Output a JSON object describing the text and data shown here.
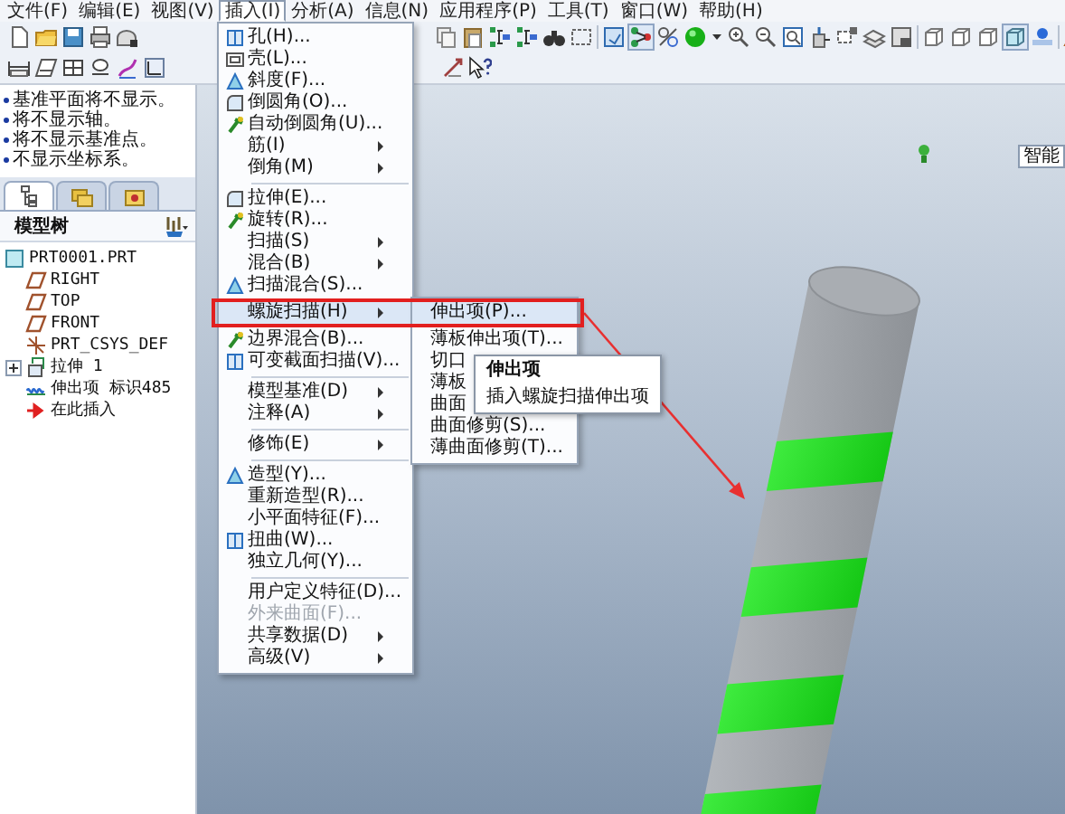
{
  "menu_bar": [
    {
      "label": "文件(F)",
      "selected": false
    },
    {
      "label": "编辑(E)",
      "selected": false
    },
    {
      "label": "视图(V)",
      "selected": false
    },
    {
      "label": "插入(I)",
      "selected": true
    },
    {
      "label": "分析(A)",
      "selected": false
    },
    {
      "label": "信息(N)",
      "selected": false
    },
    {
      "label": "应用程序(P)",
      "selected": false
    },
    {
      "label": "工具(T)",
      "selected": false
    },
    {
      "label": "窗口(W)",
      "selected": false
    },
    {
      "label": "帮助(H)",
      "selected": false
    }
  ],
  "messages": [
    "基准平面将不显示。",
    "将不显示轴。",
    "将不显示基准点。",
    "不显示坐标系。"
  ],
  "panel_tabs": [
    {
      "kind": "tree",
      "selected": true
    },
    {
      "kind": "folders",
      "selected": false
    },
    {
      "kind": "favorites",
      "selected": false
    }
  ],
  "model_tree": {
    "title": "模型树",
    "items": [
      {
        "label": "PRT0001.PRT",
        "kind": "part",
        "children": [
          {
            "label": "RIGHT",
            "kind": "plane"
          },
          {
            "label": "TOP",
            "kind": "plane"
          },
          {
            "label": "FRONT",
            "kind": "plane"
          },
          {
            "label": "PRT_CSYS_DEF",
            "kind": "csys"
          },
          {
            "label": "拉伸 1",
            "kind": "extrude",
            "expanded": false
          },
          {
            "label": "伸出项 标识485",
            "kind": "helix"
          },
          {
            "label": "在此插入",
            "kind": "insert"
          }
        ]
      }
    ]
  },
  "insert_menu": {
    "items": [
      {
        "label": "孔(H)...",
        "kind": "action",
        "icon": true,
        "selected": false,
        "disabled": false
      },
      {
        "label": "壳(L)...",
        "kind": "action",
        "icon": true,
        "selected": false,
        "disabled": false
      },
      {
        "label": "斜度(F)...",
        "kind": "action",
        "icon": true,
        "selected": false,
        "disabled": false
      },
      {
        "label": "倒圆角(O)...",
        "kind": "action",
        "icon": true,
        "selected": false,
        "disabled": false
      },
      {
        "label": "自动倒圆角(U)...",
        "kind": "action",
        "icon": true,
        "selected": false,
        "disabled": false
      },
      {
        "label": "筋(I)",
        "kind": "submenu",
        "selected": false,
        "disabled": false
      },
      {
        "label": "倒角(M)",
        "kind": "submenu",
        "selected": false,
        "disabled": false
      },
      {
        "kind": "separator"
      },
      {
        "label": "拉伸(E)...",
        "kind": "action",
        "icon": true,
        "selected": false,
        "disabled": false
      },
      {
        "label": "旋转(R)...",
        "kind": "action",
        "icon": true,
        "selected": false,
        "disabled": false
      },
      {
        "label": "扫描(S)",
        "kind": "submenu",
        "selected": false,
        "disabled": false
      },
      {
        "label": "混合(B)",
        "kind": "submenu",
        "selected": false,
        "disabled": false
      },
      {
        "label": "扫描混合(S)...",
        "kind": "action",
        "icon": true,
        "selected": false,
        "disabled": false
      },
      {
        "label": "螺旋扫描(H)",
        "kind": "submenu",
        "selected": true,
        "disabled": false
      },
      {
        "label": "边界混合(B)...",
        "kind": "action",
        "icon": true,
        "selected": false,
        "disabled": false
      },
      {
        "label": "可变截面扫描(V)...",
        "kind": "action",
        "icon": true,
        "selected": false,
        "disabled": false
      },
      {
        "kind": "separator"
      },
      {
        "label": "模型基准(D)",
        "kind": "submenu",
        "selected": false,
        "disabled": false
      },
      {
        "label": "注释(A)",
        "kind": "submenu",
        "selected": false,
        "disabled": false
      },
      {
        "kind": "separator"
      },
      {
        "label": "修饰(E)",
        "kind": "submenu",
        "selected": false,
        "disabled": false
      },
      {
        "kind": "separator"
      },
      {
        "label": "造型(Y)...",
        "kind": "action",
        "icon": true,
        "selected": false,
        "disabled": false
      },
      {
        "label": "重新造型(R)...",
        "kind": "action",
        "selected": false,
        "disabled": false
      },
      {
        "label": "小平面特征(F)...",
        "kind": "action",
        "selected": false,
        "disabled": false
      },
      {
        "label": "扭曲(W)...",
        "kind": "action",
        "icon": true,
        "selected": false,
        "disabled": false
      },
      {
        "label": "独立几何(Y)...",
        "kind": "action",
        "selected": false,
        "disabled": false
      },
      {
        "kind": "separator"
      },
      {
        "label": "用户定义特征(D)...",
        "kind": "action",
        "selected": false,
        "disabled": false
      },
      {
        "label": "外来曲面(F)...",
        "kind": "action",
        "selected": false,
        "disabled": true
      },
      {
        "label": "共享数据(D)",
        "kind": "submenu",
        "selected": false,
        "disabled": false
      },
      {
        "label": "高级(V)",
        "kind": "submenu",
        "selected": false,
        "disabled": false
      }
    ]
  },
  "helical_submenu": {
    "items": [
      {
        "label": "伸出项(P)...",
        "selected": true
      },
      {
        "label": "薄板伸出项(T)...",
        "selected": false
      },
      {
        "label": "切口",
        "selected": false
      },
      {
        "label": "薄板",
        "selected": false
      },
      {
        "label": "曲面",
        "selected": false
      },
      {
        "label": "曲面修剪(S)...",
        "selected": false
      },
      {
        "label": "薄曲面修剪(T)...",
        "selected": false
      }
    ]
  },
  "tooltip": {
    "title": "伸出项",
    "text": "插入螺旋扫描伸出项"
  },
  "filter": {
    "label": "智能"
  }
}
